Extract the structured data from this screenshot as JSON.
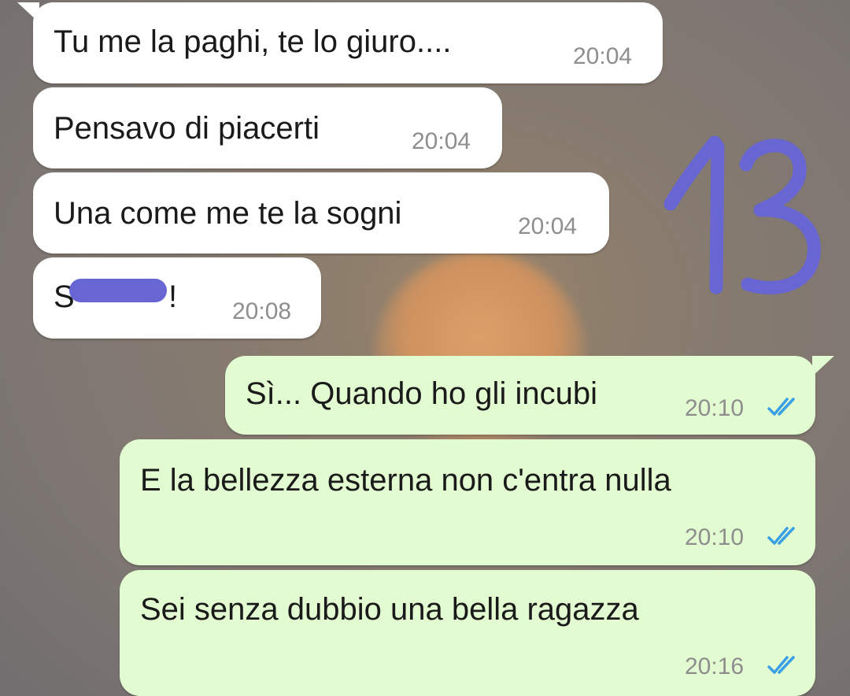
{
  "conversation": {
    "messages": [
      {
        "direction": "incoming",
        "text": "Tu me la paghi, te lo giuro....",
        "time": "20:04"
      },
      {
        "direction": "incoming",
        "text": "Pensavo di piacerti",
        "time": "20:04"
      },
      {
        "direction": "incoming",
        "text": "Una come me te la sogni",
        "time": "20:04"
      },
      {
        "direction": "incoming",
        "text": "S",
        "text_end": "!",
        "time": "20:08",
        "redacted": true
      },
      {
        "direction": "outgoing",
        "text": "Sì... Quando ho gli incubi",
        "time": "20:10",
        "status": "read"
      },
      {
        "direction": "outgoing",
        "text": "E la bellezza esterna non c'entra nulla",
        "time": "20:10",
        "status": "read"
      },
      {
        "direction": "outgoing",
        "text": "Sei senza dubbio una bella ragazza",
        "time": "20:16",
        "status": "read"
      }
    ]
  },
  "overlay": {
    "sticker_number": "13",
    "redaction_color": "#6766d2"
  },
  "colors": {
    "incoming_bubble": "#ffffff",
    "outgoing_bubble": "#e2fbd0",
    "read_ticks": "#3aa0e6",
    "timestamp": "#8e8e8e"
  },
  "icons": {
    "read_status": "double-check-icon"
  }
}
